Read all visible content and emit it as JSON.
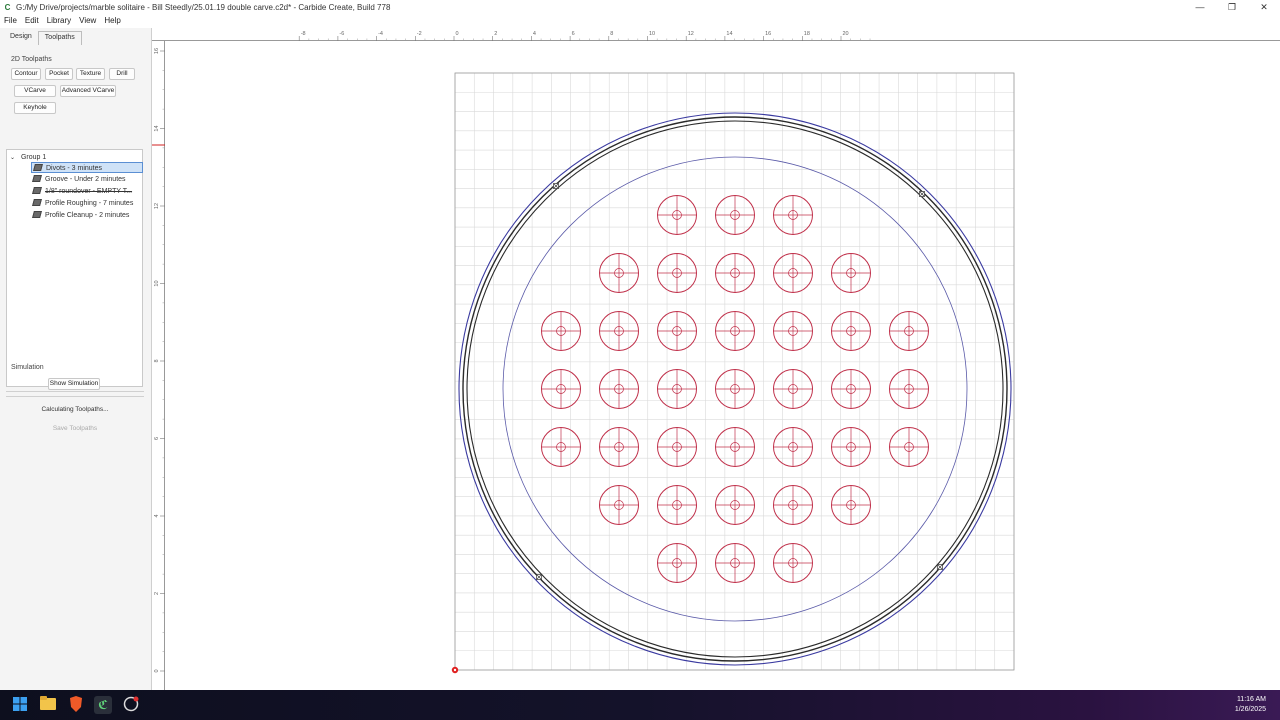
{
  "window": {
    "title": "G:/My Drive/projects/marble solitaire - Bill Steedly/25.01.19 double carve.c2d* - Carbide Create, Build 778",
    "app_icon": "C",
    "controls": [
      "—",
      "❐",
      "✕"
    ]
  },
  "menu": [
    "File",
    "Edit",
    "Library",
    "View",
    "Help"
  ],
  "tabs": {
    "design": "Design",
    "toolpaths": "Toolpaths"
  },
  "toolpaths_2d": {
    "label": "2D Toolpaths",
    "contour": "Contour",
    "pocket": "Pocket",
    "texture": "Texture",
    "drill": "Drill",
    "vcarve": "VCarve",
    "advanced_vcarve": "Advanced VCarve",
    "keyhole": "Keyhole"
  },
  "tree": {
    "group": "Group 1",
    "items": [
      "Divots - 3 minutes",
      "Groove - Under 2 minutes",
      "1/8\" roundover - EMPTY T...",
      "Profile Roughing - 7 minutes",
      "Profile Cleanup - 2 minutes"
    ]
  },
  "simulation": {
    "label": "Simulation",
    "show_button": "Show Simulation",
    "status": "Calculating Toolpaths...",
    "save_button": "Save Toolpaths"
  },
  "ruler": {
    "x_labels": [
      "-8",
      "-6",
      "-4",
      "-2",
      "0",
      "2",
      "4",
      "6",
      "8",
      "10",
      "12",
      "14",
      "16",
      "18",
      "20"
    ],
    "y_labels": [
      "16",
      "14",
      "12",
      "10",
      "8",
      "6",
      "4",
      "2",
      "0"
    ]
  },
  "colors": {
    "divot": "#c0304a",
    "inner_circle": "#5a5aa8",
    "outer_ring": "#2a2a2a",
    "outer_ring_blue": "#3a3aa0",
    "grid": "#d9d9d9"
  },
  "board": {
    "holes_per_row": [
      3,
      5,
      7,
      7,
      7,
      5,
      3
    ]
  },
  "taskbar": {
    "time": "11:16 AM",
    "date": "1/26/2025"
  }
}
